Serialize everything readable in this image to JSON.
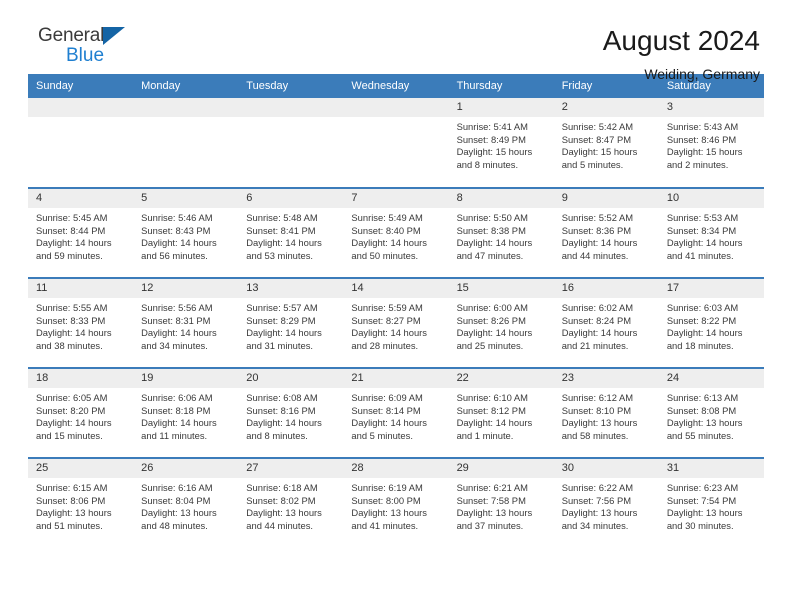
{
  "brand": {
    "word1": "General",
    "word2": "Blue",
    "color_dark": "#3b3b3b",
    "color_blue": "#1f7fd0"
  },
  "header": {
    "title": "August 2024",
    "subtitle": "Weiding, Germany",
    "accent_color": "#3b7cba"
  },
  "weekdays": [
    "Sunday",
    "Monday",
    "Tuesday",
    "Wednesday",
    "Thursday",
    "Friday",
    "Saturday"
  ],
  "labels": {
    "sunrise": "Sunrise:",
    "sunset": "Sunset:",
    "daylight": "Daylight:"
  },
  "weeks": [
    [
      {
        "day": "",
        "sunrise": "",
        "sunset": "",
        "daylight1": "",
        "daylight2": ""
      },
      {
        "day": "",
        "sunrise": "",
        "sunset": "",
        "daylight1": "",
        "daylight2": ""
      },
      {
        "day": "",
        "sunrise": "",
        "sunset": "",
        "daylight1": "",
        "daylight2": ""
      },
      {
        "day": "",
        "sunrise": "",
        "sunset": "",
        "daylight1": "",
        "daylight2": ""
      },
      {
        "day": "1",
        "sunrise": "Sunrise: 5:41 AM",
        "sunset": "Sunset: 8:49 PM",
        "daylight1": "Daylight: 15 hours",
        "daylight2": "and 8 minutes."
      },
      {
        "day": "2",
        "sunrise": "Sunrise: 5:42 AM",
        "sunset": "Sunset: 8:47 PM",
        "daylight1": "Daylight: 15 hours",
        "daylight2": "and 5 minutes."
      },
      {
        "day": "3",
        "sunrise": "Sunrise: 5:43 AM",
        "sunset": "Sunset: 8:46 PM",
        "daylight1": "Daylight: 15 hours",
        "daylight2": "and 2 minutes."
      }
    ],
    [
      {
        "day": "4",
        "sunrise": "Sunrise: 5:45 AM",
        "sunset": "Sunset: 8:44 PM",
        "daylight1": "Daylight: 14 hours",
        "daylight2": "and 59 minutes."
      },
      {
        "day": "5",
        "sunrise": "Sunrise: 5:46 AM",
        "sunset": "Sunset: 8:43 PM",
        "daylight1": "Daylight: 14 hours",
        "daylight2": "and 56 minutes."
      },
      {
        "day": "6",
        "sunrise": "Sunrise: 5:48 AM",
        "sunset": "Sunset: 8:41 PM",
        "daylight1": "Daylight: 14 hours",
        "daylight2": "and 53 minutes."
      },
      {
        "day": "7",
        "sunrise": "Sunrise: 5:49 AM",
        "sunset": "Sunset: 8:40 PM",
        "daylight1": "Daylight: 14 hours",
        "daylight2": "and 50 minutes."
      },
      {
        "day": "8",
        "sunrise": "Sunrise: 5:50 AM",
        "sunset": "Sunset: 8:38 PM",
        "daylight1": "Daylight: 14 hours",
        "daylight2": "and 47 minutes."
      },
      {
        "day": "9",
        "sunrise": "Sunrise: 5:52 AM",
        "sunset": "Sunset: 8:36 PM",
        "daylight1": "Daylight: 14 hours",
        "daylight2": "and 44 minutes."
      },
      {
        "day": "10",
        "sunrise": "Sunrise: 5:53 AM",
        "sunset": "Sunset: 8:34 PM",
        "daylight1": "Daylight: 14 hours",
        "daylight2": "and 41 minutes."
      }
    ],
    [
      {
        "day": "11",
        "sunrise": "Sunrise: 5:55 AM",
        "sunset": "Sunset: 8:33 PM",
        "daylight1": "Daylight: 14 hours",
        "daylight2": "and 38 minutes."
      },
      {
        "day": "12",
        "sunrise": "Sunrise: 5:56 AM",
        "sunset": "Sunset: 8:31 PM",
        "daylight1": "Daylight: 14 hours",
        "daylight2": "and 34 minutes."
      },
      {
        "day": "13",
        "sunrise": "Sunrise: 5:57 AM",
        "sunset": "Sunset: 8:29 PM",
        "daylight1": "Daylight: 14 hours",
        "daylight2": "and 31 minutes."
      },
      {
        "day": "14",
        "sunrise": "Sunrise: 5:59 AM",
        "sunset": "Sunset: 8:27 PM",
        "daylight1": "Daylight: 14 hours",
        "daylight2": "and 28 minutes."
      },
      {
        "day": "15",
        "sunrise": "Sunrise: 6:00 AM",
        "sunset": "Sunset: 8:26 PM",
        "daylight1": "Daylight: 14 hours",
        "daylight2": "and 25 minutes."
      },
      {
        "day": "16",
        "sunrise": "Sunrise: 6:02 AM",
        "sunset": "Sunset: 8:24 PM",
        "daylight1": "Daylight: 14 hours",
        "daylight2": "and 21 minutes."
      },
      {
        "day": "17",
        "sunrise": "Sunrise: 6:03 AM",
        "sunset": "Sunset: 8:22 PM",
        "daylight1": "Daylight: 14 hours",
        "daylight2": "and 18 minutes."
      }
    ],
    [
      {
        "day": "18",
        "sunrise": "Sunrise: 6:05 AM",
        "sunset": "Sunset: 8:20 PM",
        "daylight1": "Daylight: 14 hours",
        "daylight2": "and 15 minutes."
      },
      {
        "day": "19",
        "sunrise": "Sunrise: 6:06 AM",
        "sunset": "Sunset: 8:18 PM",
        "daylight1": "Daylight: 14 hours",
        "daylight2": "and 11 minutes."
      },
      {
        "day": "20",
        "sunrise": "Sunrise: 6:08 AM",
        "sunset": "Sunset: 8:16 PM",
        "daylight1": "Daylight: 14 hours",
        "daylight2": "and 8 minutes."
      },
      {
        "day": "21",
        "sunrise": "Sunrise: 6:09 AM",
        "sunset": "Sunset: 8:14 PM",
        "daylight1": "Daylight: 14 hours",
        "daylight2": "and 5 minutes."
      },
      {
        "day": "22",
        "sunrise": "Sunrise: 6:10 AM",
        "sunset": "Sunset: 8:12 PM",
        "daylight1": "Daylight: 14 hours",
        "daylight2": "and 1 minute."
      },
      {
        "day": "23",
        "sunrise": "Sunrise: 6:12 AM",
        "sunset": "Sunset: 8:10 PM",
        "daylight1": "Daylight: 13 hours",
        "daylight2": "and 58 minutes."
      },
      {
        "day": "24",
        "sunrise": "Sunrise: 6:13 AM",
        "sunset": "Sunset: 8:08 PM",
        "daylight1": "Daylight: 13 hours",
        "daylight2": "and 55 minutes."
      }
    ],
    [
      {
        "day": "25",
        "sunrise": "Sunrise: 6:15 AM",
        "sunset": "Sunset: 8:06 PM",
        "daylight1": "Daylight: 13 hours",
        "daylight2": "and 51 minutes."
      },
      {
        "day": "26",
        "sunrise": "Sunrise: 6:16 AM",
        "sunset": "Sunset: 8:04 PM",
        "daylight1": "Daylight: 13 hours",
        "daylight2": "and 48 minutes."
      },
      {
        "day": "27",
        "sunrise": "Sunrise: 6:18 AM",
        "sunset": "Sunset: 8:02 PM",
        "daylight1": "Daylight: 13 hours",
        "daylight2": "and 44 minutes."
      },
      {
        "day": "28",
        "sunrise": "Sunrise: 6:19 AM",
        "sunset": "Sunset: 8:00 PM",
        "daylight1": "Daylight: 13 hours",
        "daylight2": "and 41 minutes."
      },
      {
        "day": "29",
        "sunrise": "Sunrise: 6:21 AM",
        "sunset": "Sunset: 7:58 PM",
        "daylight1": "Daylight: 13 hours",
        "daylight2": "and 37 minutes."
      },
      {
        "day": "30",
        "sunrise": "Sunrise: 6:22 AM",
        "sunset": "Sunset: 7:56 PM",
        "daylight1": "Daylight: 13 hours",
        "daylight2": "and 34 minutes."
      },
      {
        "day": "31",
        "sunrise": "Sunrise: 6:23 AM",
        "sunset": "Sunset: 7:54 PM",
        "daylight1": "Daylight: 13 hours",
        "daylight2": "and 30 minutes."
      }
    ]
  ]
}
